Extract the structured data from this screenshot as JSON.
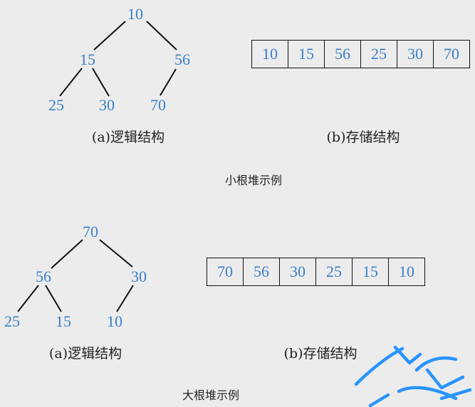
{
  "min_heap": {
    "nodes": [
      "10",
      "15",
      "56",
      "25",
      "30",
      "70"
    ],
    "array": [
      "10",
      "15",
      "56",
      "25",
      "30",
      "70"
    ],
    "caption_a": "(a)逻辑结构",
    "caption_b": "(b)存储结构",
    "title": "小根堆示例"
  },
  "max_heap": {
    "nodes": [
      "70",
      "56",
      "30",
      "25",
      "15",
      "10"
    ],
    "array": [
      "70",
      "56",
      "30",
      "25",
      "15",
      "10"
    ],
    "caption_a": "(a)逻辑结构",
    "caption_b": "(b)存储结构",
    "title": "大根堆示例"
  },
  "colors": {
    "node_text": "#3a7fc8",
    "edge": "#111111",
    "background": "#ececec",
    "watermark": "#1e90ff"
  }
}
